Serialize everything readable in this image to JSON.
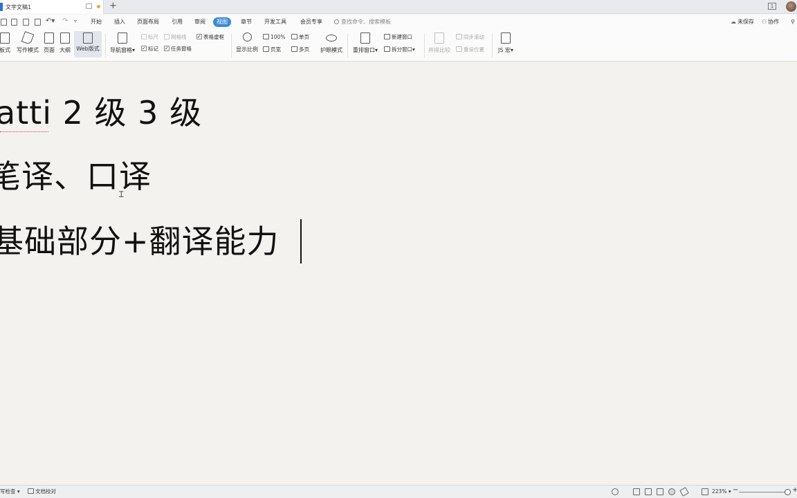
{
  "tabbar": {
    "doc_title": "文字文稿1",
    "new_tab": "+"
  },
  "menu": {
    "tabs": [
      "开始",
      "插入",
      "页面布局",
      "引用",
      "审阅",
      "视图",
      "章节",
      "开发工具",
      "会员专享"
    ],
    "active_tab": "视图",
    "search_placeholder": "查找命令、搜索模板",
    "unsaved": "未保存",
    "collaborate": "协作"
  },
  "ribbon": {
    "reading_mode": "板式",
    "writing_mode": "写作模式",
    "page": "页面",
    "outline": "大纲",
    "web_layout": "Web版式",
    "nav_pane": "导航窗格",
    "ruler": "标尺",
    "gridlines": "网格线",
    "table_gridlines": "表格虚框",
    "markup": "标记",
    "taskpane": "任务窗格",
    "display_zoom": "显示比例",
    "zoom_100": "100%",
    "single_page": "单页",
    "page_width": "页宽",
    "multi_page": "多页",
    "eye_protection": "护眼模式",
    "arrange_window": "重排窗口",
    "new_window": "新建窗口",
    "split_window": "拆分窗口",
    "side_by_side": "并排比较",
    "sync_scroll": "同步滚动",
    "reset_position": "重设位置",
    "js_macro": "JS 宏"
  },
  "document": {
    "line1": "atti 2 级  3 级",
    "line2": "笔译、口译",
    "line3": "基础部分+翻译能力"
  },
  "statusbar": {
    "spell_check": "写检查",
    "doc_proofread": "文档校对",
    "zoom_level": "223%",
    "zoom_minus": "−",
    "zoom_plus": "+"
  }
}
